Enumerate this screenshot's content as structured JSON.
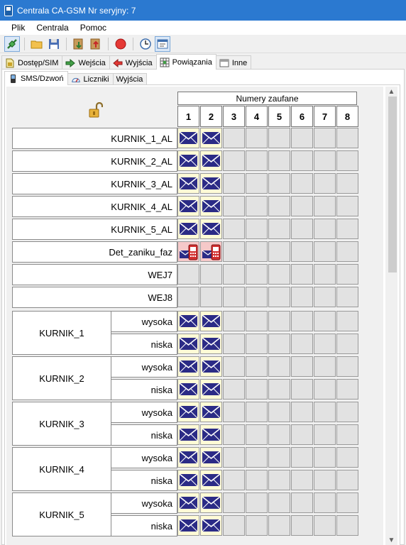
{
  "window": {
    "title": "Centrala CA-GSM  Nr seryjny: 7"
  },
  "menu": [
    "Plik",
    "Centrala",
    "Pomoc"
  ],
  "toolbar": {
    "buttons": [
      "connect-icon",
      "open-folder-icon",
      "save-icon",
      "read-from-device-icon",
      "write-to-device-icon",
      "stop-icon",
      "clock-icon",
      "settings-window-icon"
    ]
  },
  "tabs_main": [
    {
      "label": "Dostęp/SIM",
      "icon": "sim-icon"
    },
    {
      "label": "Wejścia",
      "icon": "arrow-right-icon"
    },
    {
      "label": "Wyjścia",
      "icon": "arrow-left-icon"
    },
    {
      "label": "Powiązania",
      "icon": "grid-icon",
      "selected": true
    },
    {
      "label": "Inne",
      "icon": "window-icon"
    }
  ],
  "tabs_sub": [
    {
      "label": "SMS/Dzwoń",
      "icon": "phone-icon",
      "selected": true
    },
    {
      "label": "Liczniki",
      "icon": "gauge-icon"
    },
    {
      "label": "Wyjścia",
      "icon": ""
    }
  ],
  "grid": {
    "header": "Numery zaufane",
    "columns": [
      "1",
      "2",
      "3",
      "4",
      "5",
      "6",
      "7",
      "8"
    ],
    "inputs": [
      {
        "label": "KURNIK_1_AL",
        "cells": [
          "sms",
          "sms",
          "",
          "",
          "",
          "",
          "",
          ""
        ]
      },
      {
        "label": "KURNIK_2_AL",
        "cells": [
          "sms",
          "sms",
          "",
          "",
          "",
          "",
          "",
          ""
        ]
      },
      {
        "label": "KURNIK_3_AL",
        "cells": [
          "sms",
          "sms",
          "",
          "",
          "",
          "",
          "",
          ""
        ]
      },
      {
        "label": "KURNIK_4_AL",
        "cells": [
          "sms",
          "sms",
          "",
          "",
          "",
          "",
          "",
          ""
        ]
      },
      {
        "label": "KURNIK_5_AL",
        "cells": [
          "sms",
          "sms",
          "",
          "",
          "",
          "",
          "",
          ""
        ]
      },
      {
        "label": "Det_zaniku_faz",
        "cells": [
          "call",
          "call",
          "",
          "",
          "",
          "",
          "",
          ""
        ]
      },
      {
        "label": "WEJ7",
        "cells": [
          "",
          "",
          "",
          "",
          "",
          "",
          "",
          ""
        ]
      },
      {
        "label": "WEJ8",
        "cells": [
          "",
          "",
          "",
          "",
          "",
          "",
          "",
          ""
        ]
      }
    ],
    "groups": [
      {
        "label": "KURNIK_1",
        "rows": [
          {
            "label": "wysoka",
            "cells": [
              "sms",
              "sms",
              "",
              "",
              "",
              "",
              "",
              ""
            ]
          },
          {
            "label": "niska",
            "cells": [
              "sms",
              "sms",
              "",
              "",
              "",
              "",
              "",
              ""
            ]
          }
        ]
      },
      {
        "label": "KURNIK_2",
        "rows": [
          {
            "label": "wysoka",
            "cells": [
              "sms",
              "sms",
              "",
              "",
              "",
              "",
              "",
              ""
            ]
          },
          {
            "label": "niska",
            "cells": [
              "sms",
              "sms",
              "",
              "",
              "",
              "",
              "",
              ""
            ]
          }
        ]
      },
      {
        "label": "KURNIK_3",
        "rows": [
          {
            "label": "wysoka",
            "cells": [
              "sms",
              "sms",
              "",
              "",
              "",
              "",
              "",
              ""
            ]
          },
          {
            "label": "niska",
            "cells": [
              "sms",
              "sms",
              "",
              "",
              "",
              "",
              "",
              ""
            ]
          }
        ]
      },
      {
        "label": "KURNIK_4",
        "rows": [
          {
            "label": "wysoka",
            "cells": [
              "sms",
              "sms",
              "",
              "",
              "",
              "",
              "",
              ""
            ]
          },
          {
            "label": "niska",
            "cells": [
              "sms",
              "sms",
              "",
              "",
              "",
              "",
              "",
              ""
            ]
          }
        ]
      },
      {
        "label": "KURNIK_5",
        "rows": [
          {
            "label": "wysoka",
            "cells": [
              "sms",
              "sms",
              "",
              "",
              "",
              "",
              "",
              ""
            ]
          },
          {
            "label": "niska",
            "cells": [
              "sms",
              "sms",
              "",
              "",
              "",
              "",
              "",
              ""
            ]
          }
        ]
      }
    ]
  },
  "colors": {
    "titlebar": "#2b79d0",
    "sms_cell": "#fffbd6",
    "call_cell": "#f6c9c9",
    "empty_cell": "#e2e2e2",
    "envelope": "#2b2b86"
  }
}
